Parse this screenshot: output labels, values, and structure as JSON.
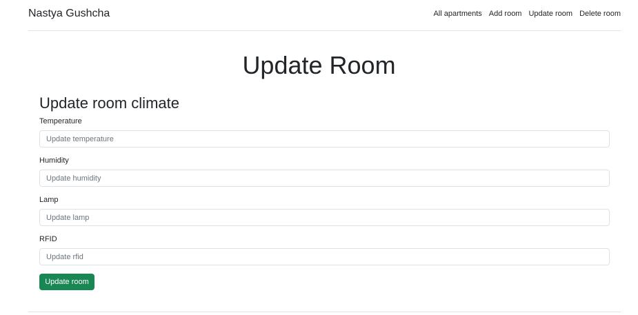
{
  "navbar": {
    "brand": "Nastya Gushcha",
    "links": [
      "All apartments",
      "Add room",
      "Update room",
      "Delete room"
    ]
  },
  "page_title": "Update Room",
  "form": {
    "title": "Update room climate",
    "fields": [
      {
        "label": "Temperature",
        "placeholder": "Update temperature"
      },
      {
        "label": "Humidity",
        "placeholder": "Update humidity"
      },
      {
        "label": "Lamp",
        "placeholder": "Update lamp"
      },
      {
        "label": "RFID",
        "placeholder": "Update rfid"
      }
    ],
    "submit_label": "Update room"
  },
  "colors": {
    "accent": "#198754",
    "divider": "#e3e3e3",
    "text": "#212529"
  }
}
